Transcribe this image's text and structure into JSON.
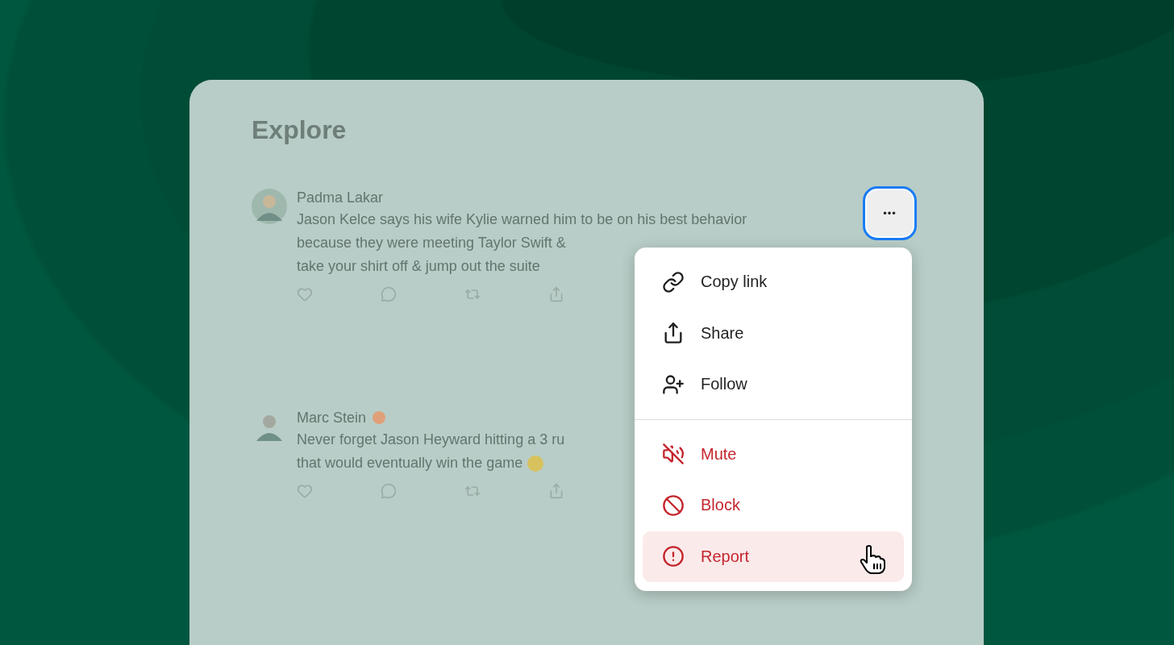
{
  "page": {
    "title": "Explore"
  },
  "posts": [
    {
      "author": "Padma Lakar",
      "verified": false,
      "emoji": false,
      "lines": [
        "Jason Kelce says his wife Kylie warned him to be on his best behavior",
        "because they were meeting Taylor Swift &",
        "take your shirt off & jump out the suite"
      ]
    },
    {
      "author": "Marc Stein",
      "verified": true,
      "emoji": true,
      "lines": [
        "Never forget Jason Heyward hitting a 3 ru",
        "that would eventually win the game"
      ]
    }
  ],
  "more_button": {
    "label": "•••",
    "focused": true
  },
  "menu": {
    "groups": [
      [
        {
          "label": "Copy link",
          "kind": "normal",
          "selected": false
        },
        {
          "label": "Share",
          "kind": "normal",
          "selected": false
        },
        {
          "label": "Follow",
          "kind": "normal",
          "selected": false
        }
      ],
      [
        {
          "label": "Mute",
          "kind": "danger",
          "selected": false
        },
        {
          "label": "Block",
          "kind": "danger",
          "selected": false
        },
        {
          "label": "Report",
          "kind": "danger",
          "selected": true
        }
      ]
    ]
  }
}
